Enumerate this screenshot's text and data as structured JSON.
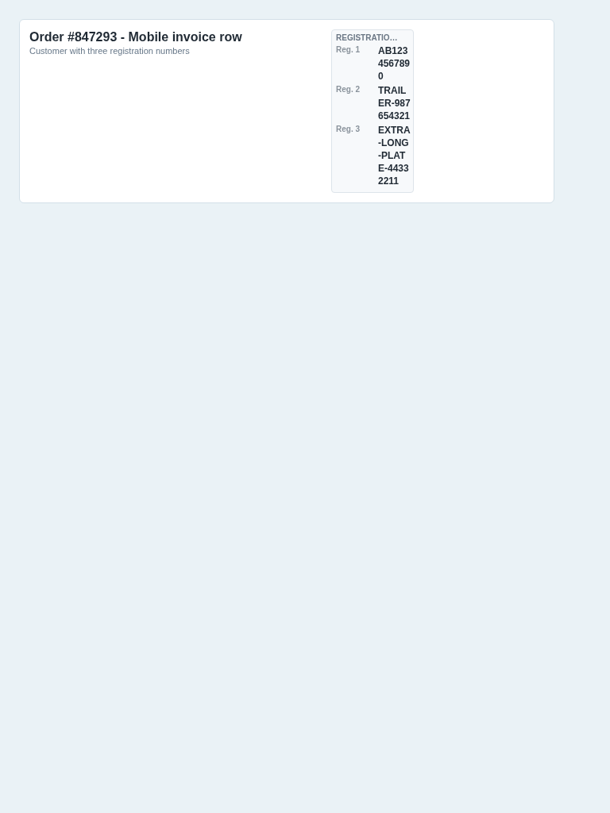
{
  "order": {
    "title": "Order #847293 - Mobile invoice row",
    "subtitle": "Customer with three registration numbers"
  },
  "registrations": {
    "heading": "REGISTRATIO…",
    "items": [
      {
        "label": "Reg. 1",
        "value": "AB1234567890"
      },
      {
        "label": "Reg. 2",
        "value": "TRAILER-987654321"
      },
      {
        "label": "Reg. 3",
        "value": "EXTRA-LONG-PLATE-44332211"
      }
    ]
  }
}
